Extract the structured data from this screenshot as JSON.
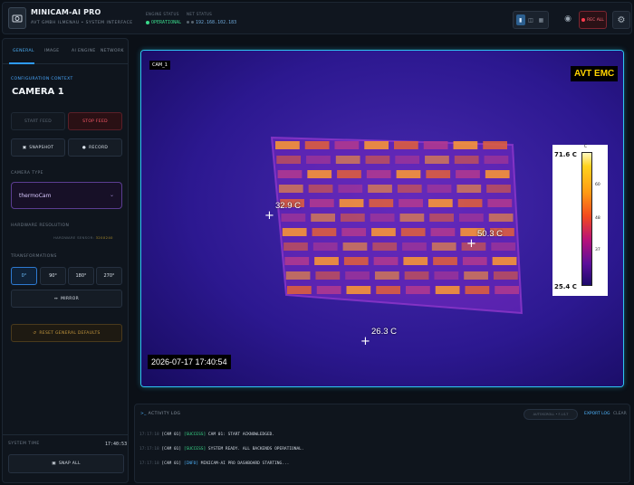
{
  "header": {
    "title": "MINICAM-AI PRO",
    "subtitle": "AVT GMBH ILMENAU • SYSTEM INTERFACE",
    "engine_status_label": "ENGINE STATUS",
    "engine_status_value": "OPERATIONAL",
    "net_status_label": "NET STATUS",
    "net_status_value": "192.168.102.183",
    "rec_all_label": "REC ALL"
  },
  "sidebar": {
    "tabs": [
      "GENERAL",
      "IMAGE",
      "AI ENGINE",
      "NETWORK"
    ],
    "active_tab": "GENERAL",
    "config_context_label": "CONFIGURATION CONTEXT",
    "camera_name": "CAMERA 1",
    "start_feed": "START FEED",
    "stop_feed": "STOP FEED",
    "snapshot": "SNAPSHOT",
    "record": "RECORD",
    "camera_type_label": "CAMERA TYPE",
    "camera_type_value": "thermoCam",
    "hw_resolution_label": "HARDWARE RESOLUTION",
    "hw_sensor_prefix": "HARDWARE SENSOR:",
    "hw_sensor_value": "320X240",
    "transformations_label": "TRANSFORMATIONS",
    "rotations": [
      "0°",
      "90°",
      "180°",
      "270°"
    ],
    "mirror": "MIRROR",
    "reset_defaults": "RESET GENERAL DEFAULTS",
    "system_time_label": "SYSTEM TIME",
    "system_time_value": "17:40:53",
    "snap_all": "SNAP ALL"
  },
  "viewer": {
    "cam_tag": "CAM_1",
    "brand": "AVT EMC",
    "timestamp": "2026-07-17 17:40:54",
    "spots": [
      "32.9 C",
      "50.3 C",
      "26.3 C"
    ],
    "scale_max": "71.6 C",
    "scale_min": "25.4 C",
    "scale_unit": "C",
    "scale_ticks": [
      "60",
      "48",
      "37"
    ]
  },
  "log": {
    "title": "ACTIVITY LOG",
    "filter_placeholder": "AUTOSCROLL • F-I-S-T",
    "export": "EXPORT LOG",
    "clear": "CLEAR",
    "entries": [
      {
        "ts": "17:17:18",
        "cam": "[CAM 01]",
        "level": "[SUCCESS]",
        "msg": "CAM 01: START ACKNOWLEDGED."
      },
      {
        "ts": "17:17:18",
        "cam": "[CAM 01]",
        "level": "[SUCCESS]",
        "msg": "SYSTEM READY. ALL BACKENDS OPERATIONAL."
      },
      {
        "ts": "17:17:18",
        "cam": "[CAM 01]",
        "level": "[INFO]",
        "msg": "MINICAM-AI PRO DASHBOARD STARTING..."
      }
    ]
  }
}
